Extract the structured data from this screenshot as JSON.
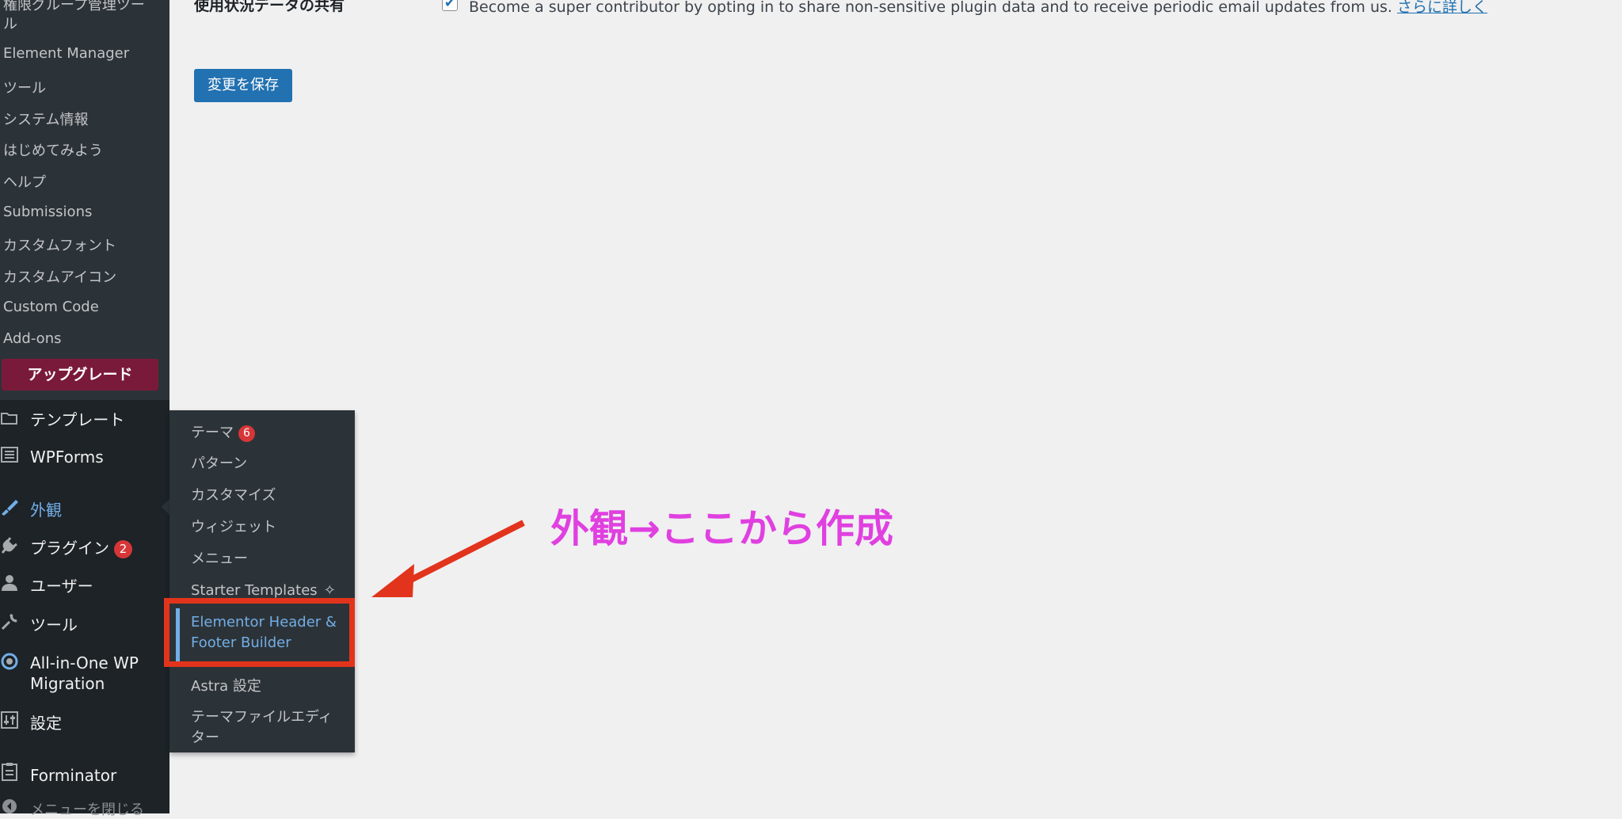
{
  "sidebar": {
    "submenu_items": [
      "権限グループ管理ツー",
      "ル",
      "Element Manager",
      "ツール",
      "システム情報",
      "はじめてみよう",
      "ヘルプ",
      "Submissions",
      "カスタムフォント",
      "カスタムアイコン",
      "Custom Code",
      "Add-ons"
    ],
    "upgrade_label": "アップグレード",
    "menu": [
      {
        "label": "テンプレート",
        "icon": "folder-icon"
      },
      {
        "label": "WPForms",
        "icon": "forms-icon"
      },
      {
        "label": "外観",
        "icon": "brush-icon",
        "active": true
      },
      {
        "label": "プラグイン",
        "icon": "plugin-icon",
        "badge": "2"
      },
      {
        "label": "ユーザー",
        "icon": "user-icon"
      },
      {
        "label": "ツール",
        "icon": "wrench-icon"
      },
      {
        "label": "All-in-One WP",
        "label2": "Migration",
        "icon": "migration-icon"
      },
      {
        "label": "設定",
        "icon": "settings-icon"
      },
      {
        "label": "Forminator",
        "icon": "clipboard-icon"
      },
      {
        "label": "メニューを閉じる",
        "icon": "collapse-icon"
      }
    ]
  },
  "flyout": {
    "items": [
      {
        "label": "テーマ",
        "badge": "6"
      },
      {
        "label": "パターン"
      },
      {
        "label": "カスタマイズ"
      },
      {
        "label": "ウィジェット"
      },
      {
        "label": "メニュー"
      },
      {
        "label": "Starter Templates"
      },
      {
        "label": "Elementor Header &",
        "label2": "Footer Builder",
        "current": true
      },
      {
        "label": "Astra 設定"
      },
      {
        "label": "テーマファイルエディ",
        "label2": "ター"
      }
    ]
  },
  "main": {
    "setting_label": "使用状況データの共有",
    "usage_text": "Become a super contributor by opting in to share non-sensitive plugin data and to receive periodic email updates from us.",
    "usage_link": "さらに詳しく",
    "save_button": "変更を保存"
  },
  "annotation": {
    "text": "外観→ここから作成",
    "color": "#e040e0",
    "arrow_color": "#e2341c"
  }
}
